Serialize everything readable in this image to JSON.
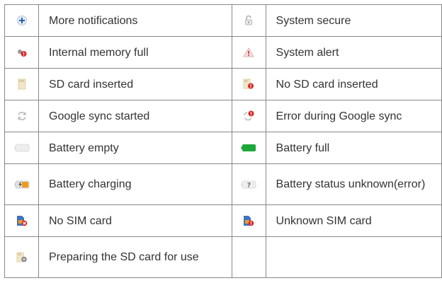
{
  "rows": [
    {
      "left": {
        "icon": "plus-notification-icon",
        "label": "More notifications"
      },
      "right": {
        "icon": "unlocked-padlock-icon",
        "label": "System secure"
      }
    },
    {
      "left": {
        "icon": "memory-full-alert-icon",
        "label": "Internal memory full"
      },
      "right": {
        "icon": "warning-triangle-icon",
        "label": "System alert"
      }
    },
    {
      "left": {
        "icon": "sd-card-icon",
        "label": "SD card inserted"
      },
      "right": {
        "icon": "no-sd-card-icon",
        "label": "No SD card inserted"
      }
    },
    {
      "left": {
        "icon": "sync-icon",
        "label": "Google sync started"
      },
      "right": {
        "icon": "sync-error-icon",
        "label": "Error during Google sync"
      }
    },
    {
      "left": {
        "icon": "battery-empty-icon",
        "label": "Battery empty"
      },
      "right": {
        "icon": "battery-full-icon",
        "label": "Battery full"
      }
    },
    {
      "left": {
        "icon": "battery-charging-icon",
        "label": "Battery charging"
      },
      "right": {
        "icon": "battery-unknown-icon",
        "label": "Battery status unknown(error)"
      }
    },
    {
      "left": {
        "icon": "no-sim-card-icon",
        "label": "No SIM card"
      },
      "right": {
        "icon": "unknown-sim-card-icon",
        "label": "Unknown SIM card"
      }
    },
    {
      "left": {
        "icon": "preparing-sd-card-icon",
        "label": "Preparing the SD card for use"
      },
      "right": {
        "icon": "",
        "label": ""
      }
    }
  ],
  "colors": {
    "border": "#888888",
    "text": "#333333",
    "alert_red": "#d62828",
    "battery_green": "#1ea83c",
    "charging_orange": "#f29a1c",
    "sim_blue": "#3f72c2"
  }
}
